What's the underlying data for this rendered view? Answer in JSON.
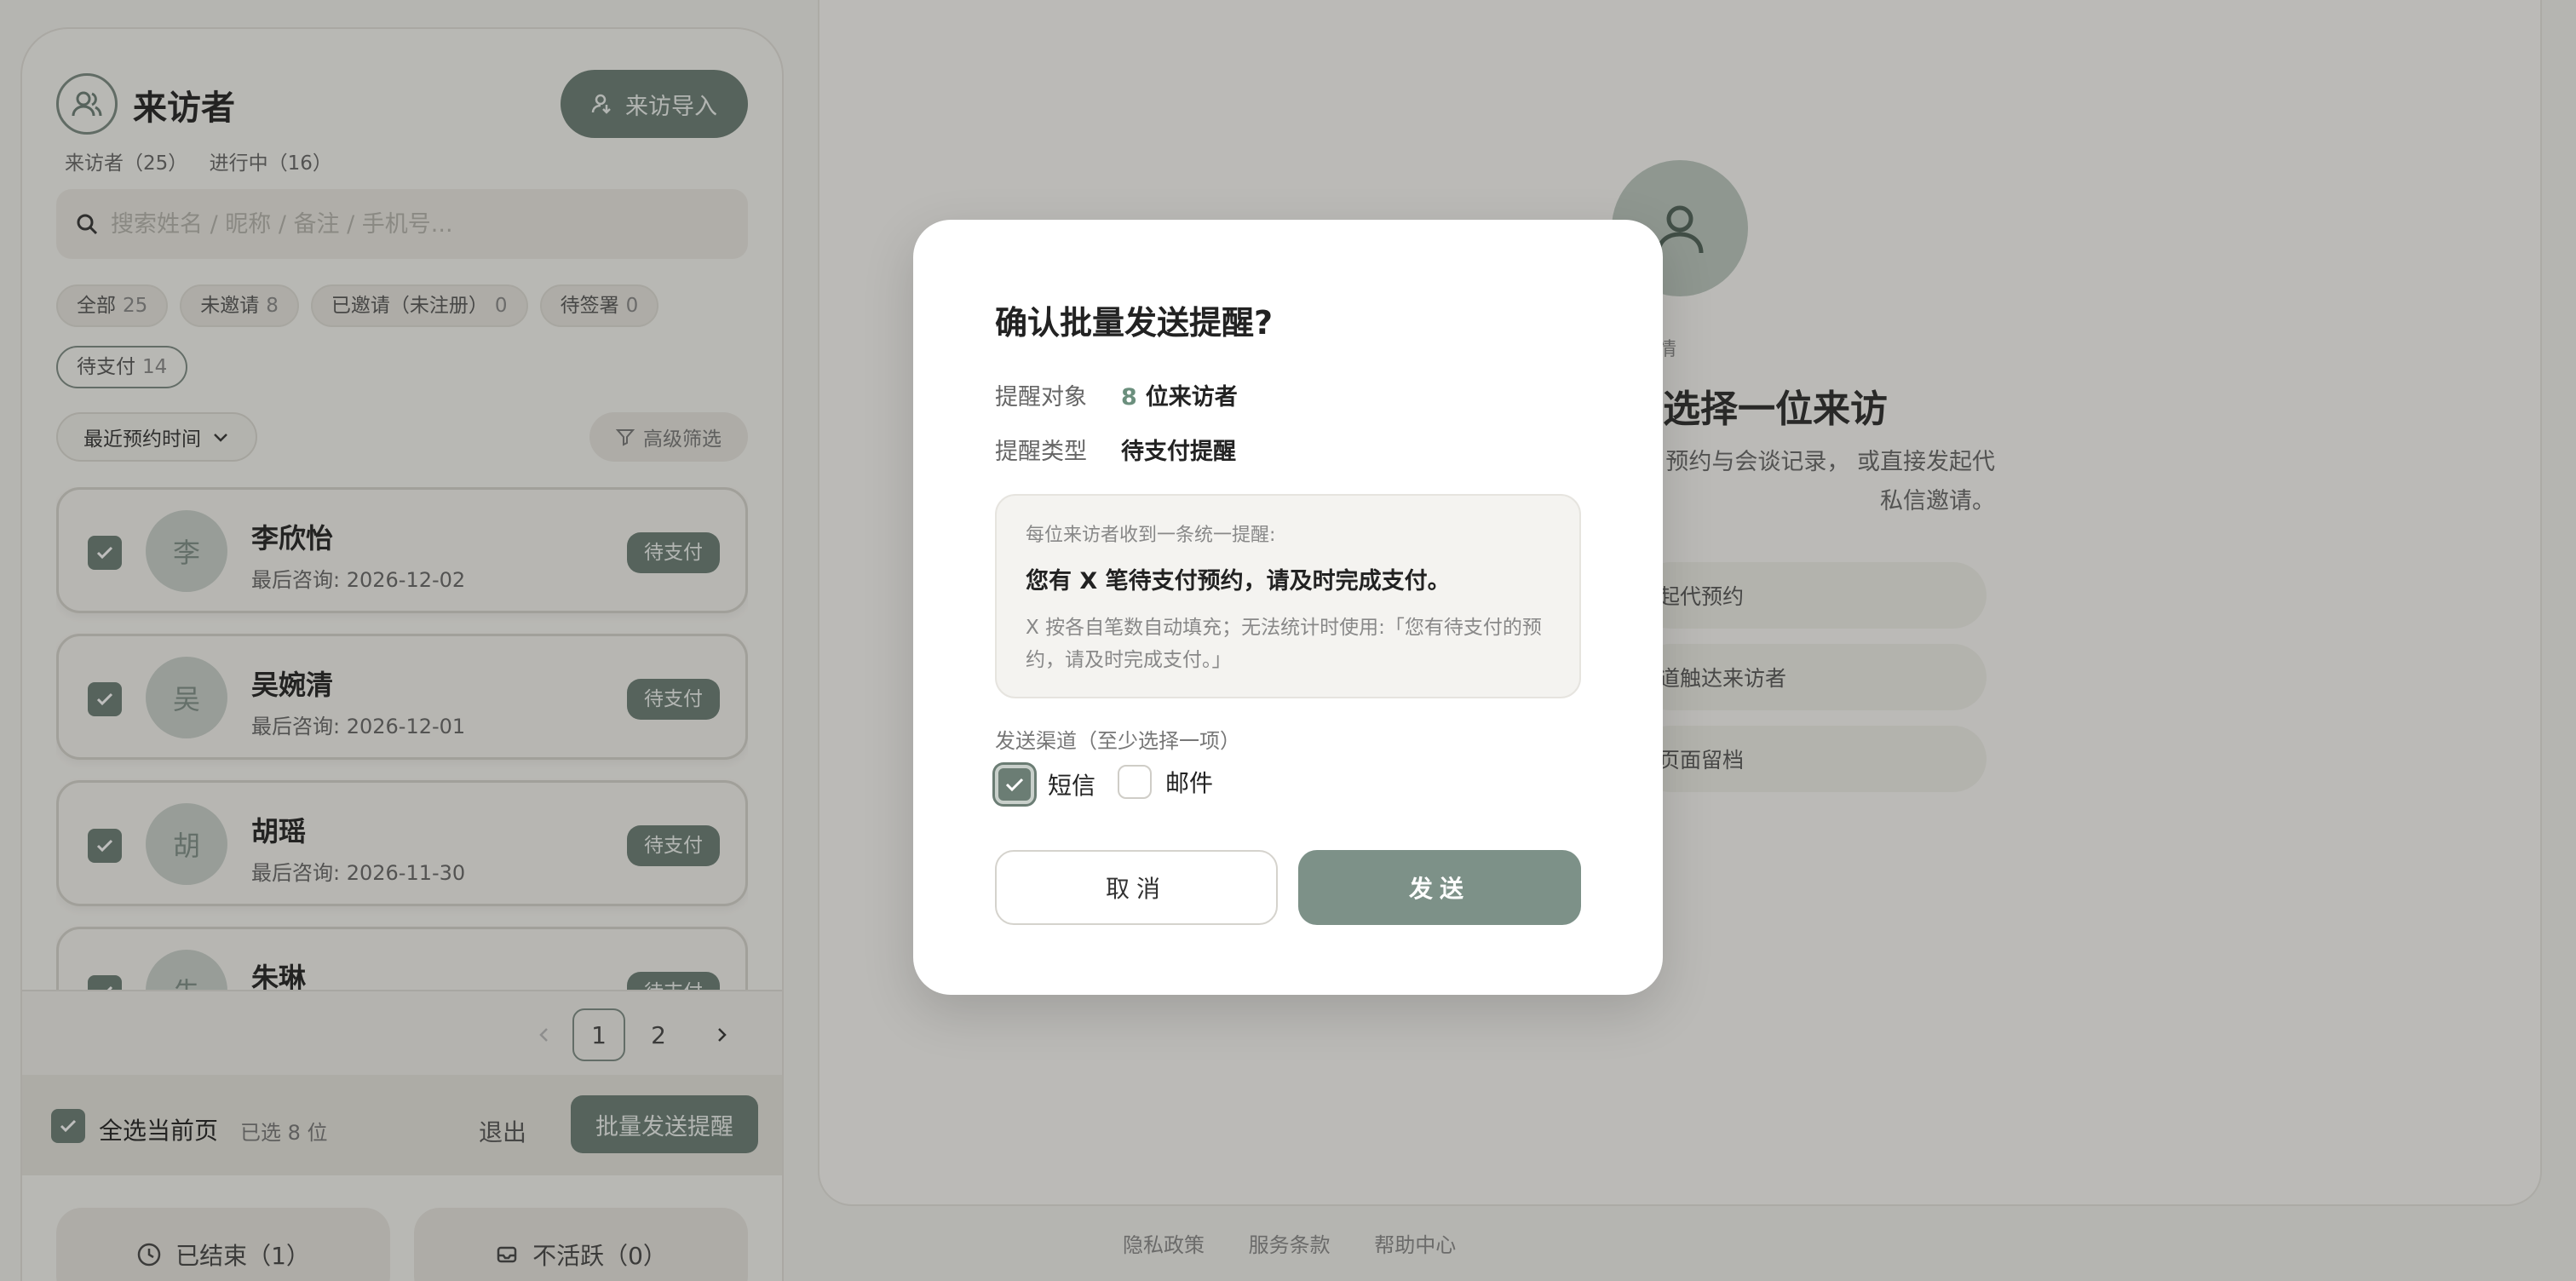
{
  "visitor_panel": {
    "title": "来访者",
    "import_label": "来访导入",
    "stats": [
      "来访者（25）",
      "进行中（16）"
    ],
    "search_placeholder": "搜索姓名 / 昵称 / 备注 / 手机号...",
    "filters": [
      {
        "label": "全部",
        "count": "25"
      },
      {
        "label": "未邀请",
        "count": "8"
      },
      {
        "label": "已邀请（未注册）",
        "count": "0"
      },
      {
        "label": "待签署",
        "count": "0"
      },
      {
        "label": "待支付",
        "count": "14"
      }
    ],
    "sort_label": "最近预约时间",
    "advanced_filter_label": "高级筛选",
    "visitors": [
      {
        "initial": "李",
        "name": "李欣怡",
        "last": "最后咨询: 2026-12-02",
        "status": "待支付"
      },
      {
        "initial": "吴",
        "name": "吴婉清",
        "last": "最后咨询: 2026-12-01",
        "status": "待支付"
      },
      {
        "initial": "胡",
        "name": "胡瑶",
        "last": "最后咨询: 2026-11-30",
        "status": "待支付"
      },
      {
        "initial": "朱",
        "name": "朱琳",
        "last": "",
        "status": "待支付"
      }
    ],
    "pagination": {
      "pages": [
        "1",
        "2"
      ],
      "current": "1"
    },
    "bulk": {
      "select_all_label": "全选当前页",
      "selected_text": "已选 8 位",
      "exit_label": "退出",
      "send_label": "批量发送提醒"
    },
    "bottom_tabs": [
      {
        "label": "已结束（1）",
        "icon": "clock-icon"
      },
      {
        "label": "不活跃（0）",
        "icon": "inbox-icon"
      }
    ]
  },
  "detail_panel": {
    "subtitle": "者详情",
    "title": "选择一位来访",
    "description": "、预约与会谈记录， 或直接发起代私信邀请。",
    "options": [
      "发起代预约",
      "渠道触达来访者",
      "一页面留档"
    ]
  },
  "footer": {
    "links": [
      "隐私政策",
      "服务条款",
      "帮助中心"
    ]
  },
  "modal": {
    "title": "确认批量发送提醒?",
    "target_label": "提醒对象",
    "target_count": "8",
    "target_unit": "位来访者",
    "type_label": "提醒类型",
    "type_value": "待支付提醒",
    "hint": "每位来访者收到一条统一提醒:",
    "message": "您有 X 笔待支付预约，请及时完成支付。",
    "note": "X 按各自笔数自动填充；无法统计时使用:「您有待支付的预约，请及时完成支付。」",
    "channel_label": "发送渠道（至少选择一项）",
    "channels": [
      {
        "label": "短信",
        "checked": true
      },
      {
        "label": "邮件",
        "checked": false
      }
    ],
    "cancel_label": "取消",
    "send_label": "发送"
  },
  "colors": {
    "accent": "#6b7d74",
    "accent_light": "#7d9188",
    "highlight_number": "#6b8f7d"
  }
}
